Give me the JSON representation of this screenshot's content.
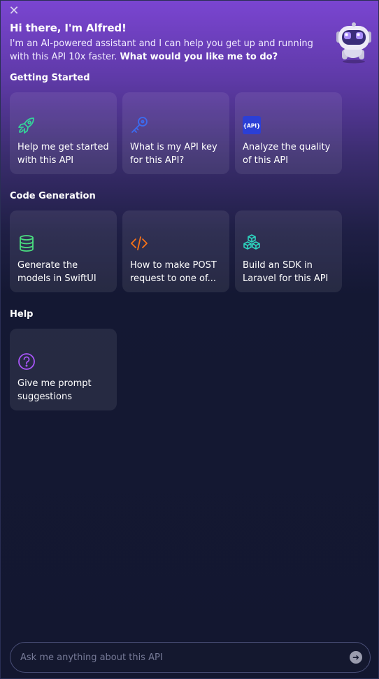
{
  "header": {
    "close_glyph": "✕",
    "title": "Hi there, I'm Alfred!",
    "intro_text": "I'm an AI-powered assistant and I can help you get up and running with this API 10x faster. ",
    "intro_bold": "What would you like me to do?"
  },
  "sections": {
    "getting_started": {
      "title": "Getting Started",
      "cards": [
        {
          "label": "Help me get started with this API",
          "icon": "rocket-icon",
          "color": "#34d399"
        },
        {
          "label": "What is my API key for this API?",
          "icon": "key-icon",
          "color": "#3b6cf2"
        },
        {
          "label": "Analyze the quality of this API",
          "icon": "api-icon",
          "icon_text": "{API}",
          "color": "#2b3fd6"
        }
      ]
    },
    "code_generation": {
      "title": "Code Generation",
      "cards": [
        {
          "label": "Generate the models in SwiftUI",
          "icon": "database-icon",
          "color": "#4ade80"
        },
        {
          "label": "How to make POST request to one of...",
          "icon": "code-icon",
          "color": "#f97316"
        },
        {
          "label": "Build an SDK in Laravel for this API",
          "icon": "cubes-icon",
          "color": "#2dd4bf"
        }
      ]
    },
    "help": {
      "title": "Help",
      "cards": [
        {
          "label": "Give me prompt suggestions",
          "icon": "question-circle-icon",
          "color": "#a855f7"
        }
      ]
    }
  },
  "input": {
    "placeholder": "Ask me anything about this API",
    "send_glyph": "➜"
  }
}
